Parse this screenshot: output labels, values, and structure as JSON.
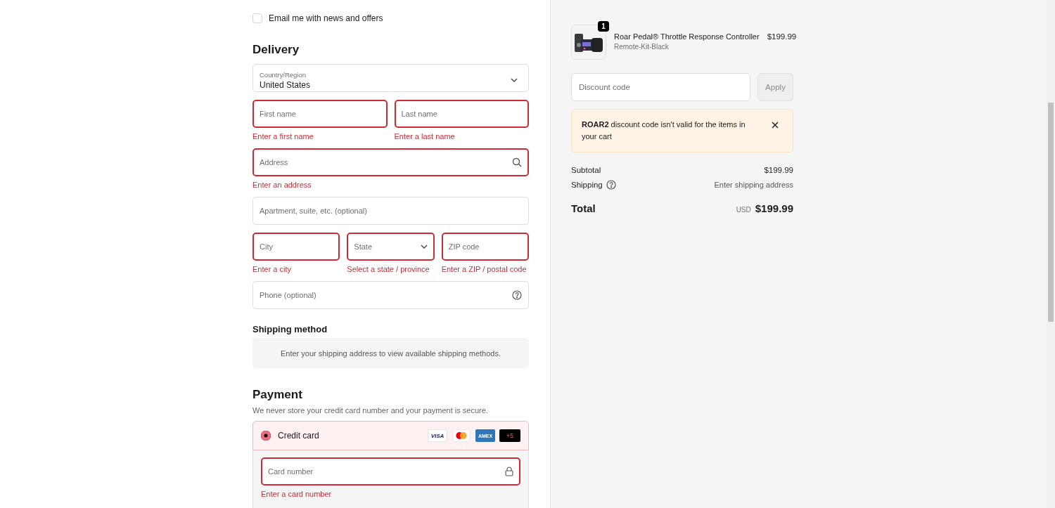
{
  "marketing": {
    "label": "Email me with news and offers",
    "checked": false
  },
  "delivery": {
    "heading": "Delivery",
    "country": {
      "label": "Country/Region",
      "value": "United States"
    },
    "rows": [
      [
        {
          "placeholder": "First name",
          "kind": "text",
          "invalid": true,
          "error": "Enter a first name"
        },
        {
          "placeholder": "Last name",
          "kind": "text",
          "invalid": true,
          "error": "Enter a last name"
        }
      ],
      [
        {
          "placeholder": "Address",
          "kind": "search",
          "invalid": true,
          "error": "Enter an address"
        }
      ],
      [
        {
          "placeholder": "Apartment, suite, etc. (optional)",
          "kind": "text",
          "invalid": false
        }
      ],
      [
        {
          "placeholder": "City",
          "kind": "text",
          "invalid": true,
          "error": "Enter a city"
        },
        {
          "placeholder": "State",
          "kind": "select",
          "invalid": true,
          "error": "Select a state / province"
        },
        {
          "placeholder": "ZIP code",
          "kind": "text",
          "invalid": true,
          "error": "Enter a ZIP / postal code"
        }
      ],
      [
        {
          "placeholder": "Phone (optional)",
          "kind": "help",
          "invalid": false
        }
      ]
    ]
  },
  "shipping_method": {
    "heading": "Shipping method",
    "notice": "Enter your shipping address to view available shipping methods."
  },
  "payment": {
    "heading": "Payment",
    "note": "We never store your credit card number and your payment is secure.",
    "methods": [
      {
        "label": "Credit card",
        "selected": true,
        "brands": [
          {
            "kind": "visa",
            "label": "VISA"
          },
          {
            "kind": "mastercard"
          },
          {
            "kind": "amex",
            "label": "AMEX"
          },
          {
            "kind": "more",
            "label": "+5"
          }
        ]
      }
    ],
    "card_field": {
      "placeholder": "Card number",
      "kind": "lock",
      "invalid": true,
      "error": "Enter a card number"
    }
  },
  "summary": {
    "items": [
      {
        "name": "Roar Pedal® Throttle Response Controller",
        "variant": "Remote-Kit-Black",
        "price": "$199.99",
        "quantity": "1"
      }
    ],
    "discount": {
      "placeholder": "Discount code",
      "button": "Apply"
    },
    "alert": {
      "message": "**ROAR2** discount code isn't valid for the items in your cart"
    },
    "lines": [
      {
        "label": "Subtotal",
        "value": "$199.99",
        "help": false
      },
      {
        "label": "Shipping",
        "value": "Enter shipping address",
        "help": true
      }
    ],
    "total": {
      "label": "Total",
      "currency": "USD",
      "value": "$199.99"
    }
  }
}
